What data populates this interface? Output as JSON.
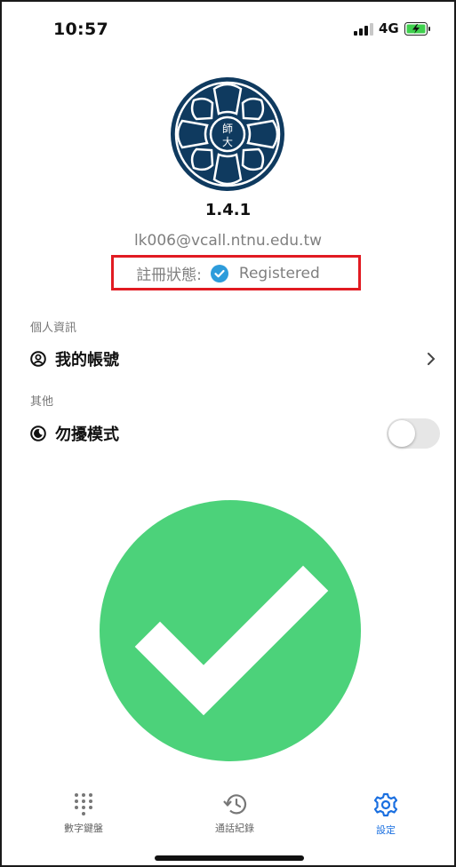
{
  "status_bar": {
    "time": "10:57",
    "network": "4G",
    "battery_state": "charging"
  },
  "app": {
    "version": "1.4.1",
    "email": "lk006@vcall.ntnu.edu.tw",
    "registration": {
      "label": "註冊狀態:",
      "value": "Registered",
      "check_color": "#2d9cdb"
    },
    "logo_color": "#0f3a5f"
  },
  "sections": {
    "personal": {
      "label": "個人資訊",
      "items": [
        {
          "label": "我的帳號",
          "icon": "user-circle-icon"
        }
      ]
    },
    "other": {
      "label": "其他",
      "items": [
        {
          "label": "勿擾模式",
          "icon": "moon-icon",
          "toggle": false
        }
      ]
    }
  },
  "overlay": {
    "icon": "success-check-icon",
    "color": "#4cd27a"
  },
  "tab_bar": {
    "tabs": [
      {
        "label": "數字鍵盤",
        "icon": "dialpad-icon",
        "active": false
      },
      {
        "label": "通話紀錄",
        "icon": "history-icon",
        "active": false
      },
      {
        "label": "設定",
        "icon": "gear-icon",
        "active": true
      }
    ],
    "active_color": "#1a6fe0"
  }
}
